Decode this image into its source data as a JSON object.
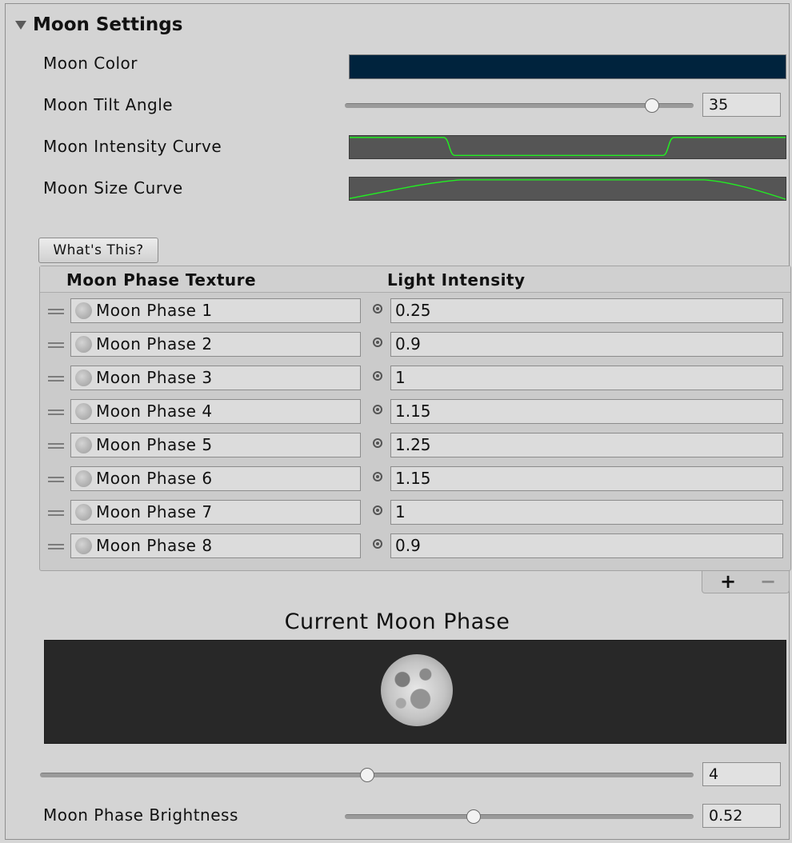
{
  "section": {
    "title": "Moon Settings"
  },
  "fields": {
    "moon_color_label": "Moon Color",
    "moon_color_value": "#00233d",
    "tilt_label": "Moon Tilt Angle",
    "tilt_value": "35",
    "tilt_fraction": 0.88,
    "intensity_curve_label": "Moon Intensity Curve",
    "size_curve_label": "Moon Size Curve",
    "curve_color": "#22ee22"
  },
  "help_button": {
    "label": "What's This?"
  },
  "phase_list": {
    "col_texture": "Moon Phase Texture",
    "col_intensity": "Light Intensity",
    "rows": [
      {
        "texture": "Moon Phase 1",
        "intensity": "0.25"
      },
      {
        "texture": "Moon Phase 2",
        "intensity": "0.9"
      },
      {
        "texture": "Moon Phase 3",
        "intensity": "1"
      },
      {
        "texture": "Moon Phase 4",
        "intensity": "1.15"
      },
      {
        "texture": "Moon Phase 5",
        "intensity": "1.25"
      },
      {
        "texture": "Moon Phase 6",
        "intensity": "1.15"
      },
      {
        "texture": "Moon Phase 7",
        "intensity": "1"
      },
      {
        "texture": "Moon Phase 8",
        "intensity": "0.9"
      }
    ],
    "add_label": "+",
    "remove_label": "−"
  },
  "current_phase": {
    "title": "Current Moon Phase",
    "value": "4",
    "fraction": 0.5
  },
  "brightness": {
    "label": "Moon Phase Brightness",
    "value": "0.52",
    "fraction": 0.37
  },
  "icons": {
    "foldout": "triangle-down-icon",
    "drag_handle": "drag-handle-icon",
    "object_picker": "target-circle-icon",
    "texture": "moon-texture-icon"
  }
}
